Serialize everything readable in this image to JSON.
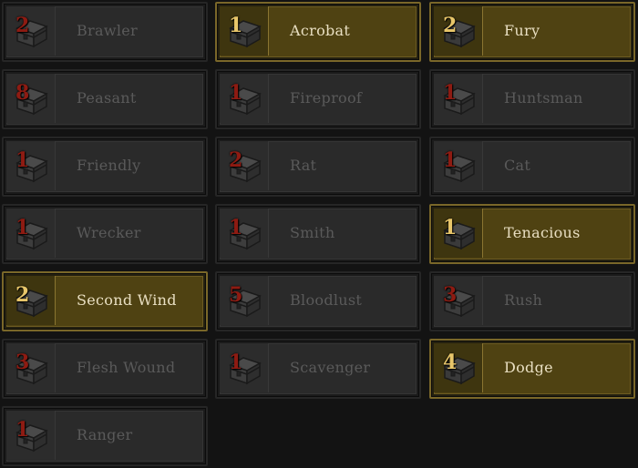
{
  "colors": {
    "background": "#131313",
    "tile_inactive": "#2a2a2a",
    "tile_active": "#4f4212",
    "active_border": "#7a6729",
    "count_inactive": "#8e1b12",
    "count_active": "#e8c66a",
    "label_inactive": "#5a5a5a",
    "label_active": "#e9dfc2"
  },
  "traits": [
    {
      "name": "Brawler",
      "count": "2",
      "active": false,
      "icon": "chest-icon"
    },
    {
      "name": "Acrobat",
      "count": "1",
      "active": true,
      "icon": "chest-icon"
    },
    {
      "name": "Fury",
      "count": "2",
      "active": true,
      "icon": "chest-icon"
    },
    {
      "name": "Peasant",
      "count": "8",
      "active": false,
      "icon": "chest-icon"
    },
    {
      "name": "Fireproof",
      "count": "1",
      "active": false,
      "icon": "chest-icon"
    },
    {
      "name": "Huntsman",
      "count": "1",
      "active": false,
      "icon": "chest-icon"
    },
    {
      "name": "Friendly",
      "count": "1",
      "active": false,
      "icon": "chest-icon"
    },
    {
      "name": "Rat",
      "count": "2",
      "active": false,
      "icon": "chest-icon"
    },
    {
      "name": "Cat",
      "count": "1",
      "active": false,
      "icon": "chest-icon"
    },
    {
      "name": "Wrecker",
      "count": "1",
      "active": false,
      "icon": "chest-icon"
    },
    {
      "name": "Smith",
      "count": "1",
      "active": false,
      "icon": "chest-icon"
    },
    {
      "name": "Tenacious",
      "count": "1",
      "active": true,
      "icon": "chest-icon"
    },
    {
      "name": "Second Wind",
      "count": "2",
      "active": true,
      "icon": "chest-icon"
    },
    {
      "name": "Bloodlust",
      "count": "5",
      "active": false,
      "icon": "chest-icon"
    },
    {
      "name": "Rush",
      "count": "3",
      "active": false,
      "icon": "chest-icon"
    },
    {
      "name": "Flesh Wound",
      "count": "3",
      "active": false,
      "icon": "chest-icon"
    },
    {
      "name": "Scavenger",
      "count": "1",
      "active": false,
      "icon": "chest-icon"
    },
    {
      "name": "Dodge",
      "count": "4",
      "active": true,
      "icon": "chest-icon"
    },
    {
      "name": "Ranger",
      "count": "1",
      "active": false,
      "icon": "chest-icon"
    }
  ]
}
